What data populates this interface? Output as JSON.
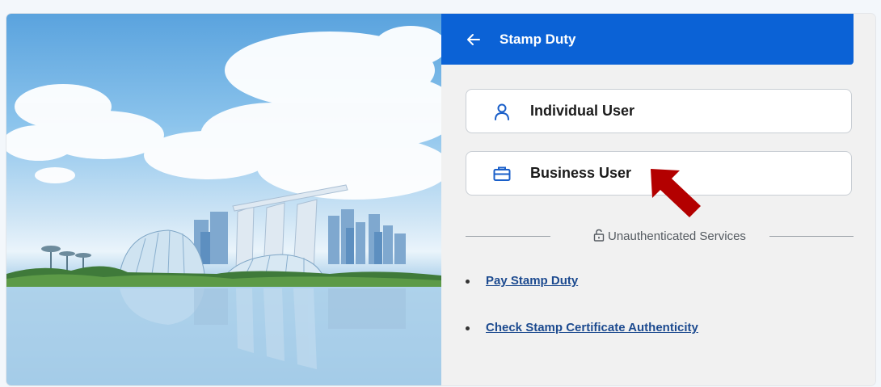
{
  "header": {
    "back_icon": "arrow-left-icon",
    "title": "Stamp Duty"
  },
  "login_options": [
    {
      "label": "Individual User",
      "icon": "person-icon"
    },
    {
      "label": "Business User",
      "icon": "briefcase-icon"
    }
  ],
  "unauthenticated": {
    "label": "Unauthenticated Services",
    "icon": "unlock-icon",
    "links": [
      {
        "label": "Pay Stamp Duty"
      },
      {
        "label": "Check Stamp Certificate Authenticity"
      }
    ]
  },
  "colors": {
    "header_bg": "#0b62d6",
    "link": "#1c4a8f",
    "pointer_arrow": "#b30000"
  },
  "annotation": {
    "icon": "red-pointer-arrow-icon"
  }
}
